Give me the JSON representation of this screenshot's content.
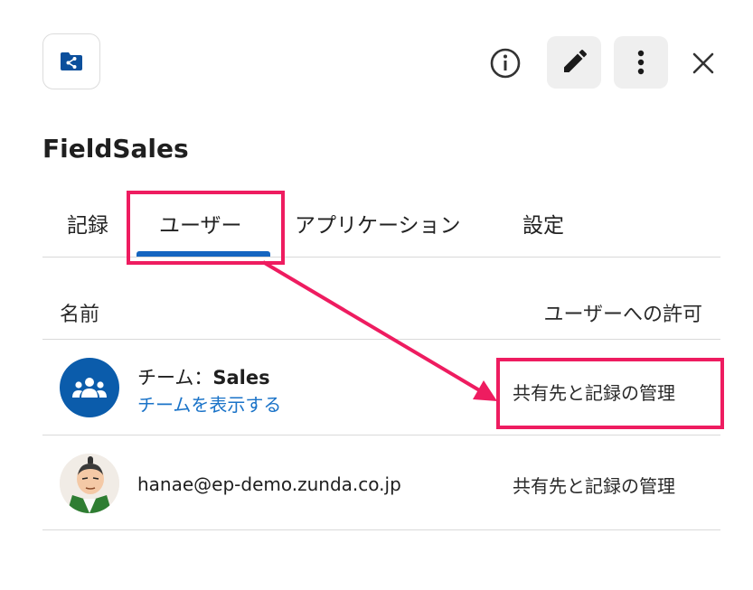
{
  "header": {
    "app_icon": "shared-folder-icon",
    "info_icon": "info-icon",
    "edit_icon": "pencil-icon",
    "more_icon": "vertical-dots-icon",
    "close_icon": "close-icon"
  },
  "title": "FieldSales",
  "tabs": [
    {
      "label": "記録"
    },
    {
      "label": "ユーザー",
      "selected": true
    },
    {
      "label": "アプリケーション"
    },
    {
      "label": "設定"
    }
  ],
  "table": {
    "columns": {
      "name": "名前",
      "permission": "ユーザーへの許可"
    },
    "rows": [
      {
        "type_prefix": "チーム：",
        "name": "Sales",
        "link": "チームを表示する",
        "permission": "共有先と記録の管理",
        "avatar_icon": "group-icon"
      },
      {
        "email": "hanae@ep-demo.zunda.co.jp",
        "permission": "共有先と記録の管理",
        "avatar_icon": "person-avatar"
      }
    ]
  },
  "colors": {
    "accent": "#1565c0",
    "link": "#1a73c8",
    "team_avatar_bg": "#0b5cab",
    "annotation": "#ee1c60"
  }
}
